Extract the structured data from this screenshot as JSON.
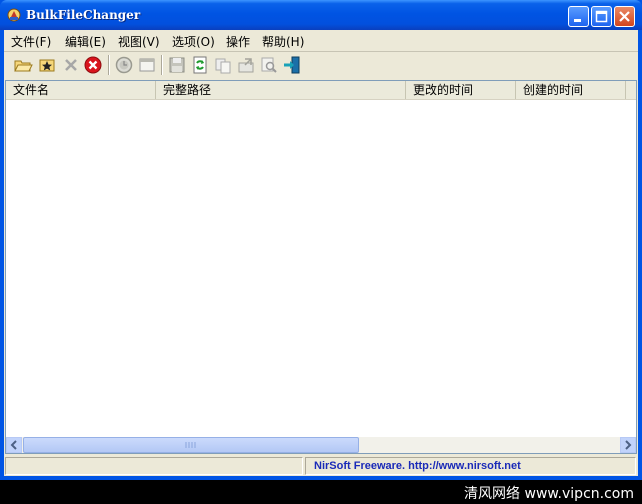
{
  "window": {
    "title": "BulkFileChanger"
  },
  "menu": {
    "items": [
      {
        "label": "文件(F)"
      },
      {
        "label": "编辑(E)"
      },
      {
        "label": "视图(V)"
      },
      {
        "label": "选项(O)"
      },
      {
        "label": "操作"
      },
      {
        "label": "帮助(H)"
      }
    ]
  },
  "toolbar": {
    "icons": [
      "open-folder-icon",
      "add-star-icon",
      "delete-icon",
      "stop-icon",
      "clock-icon",
      "window-icon",
      "save-icon",
      "refresh-icon",
      "copy-icon",
      "properties-icon",
      "search-icon",
      "exit-icon"
    ]
  },
  "list": {
    "columns": [
      {
        "label": "文件名"
      },
      {
        "label": "完整路径"
      },
      {
        "label": "更改的时间"
      },
      {
        "label": "创建的时间"
      }
    ]
  },
  "status": {
    "text": "NirSoft Freeware.  http://www.nirsoft.net"
  },
  "watermark": {
    "text": "清风网络 www.vipcn.com"
  }
}
